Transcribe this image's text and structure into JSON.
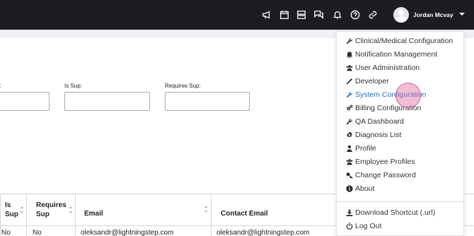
{
  "topbar": {
    "icons": [
      "megaphone-icon",
      "calendar-icon",
      "server-icon",
      "chat-icon",
      "bell-icon",
      "help-icon",
      "link-icon"
    ],
    "user_name": "Jordan Mcvay"
  },
  "filters": {
    "partial_label": ":",
    "is_sup_label": "Is Sup:",
    "requires_sup_label": "Requires Sup:"
  },
  "table": {
    "headers": {
      "is_sup": "Is\nSup",
      "requires_sup": "Requires\nSup",
      "email": "Email",
      "contact_email": "Contact Email"
    },
    "row": {
      "col0": "No",
      "requires_sup": "No",
      "email": "oleksandr@lightningstep.com",
      "contact_email": "oleksandr@lightningstep.com"
    }
  },
  "menu": {
    "items": [
      {
        "label": "Clinical/Medical Configuration",
        "icon": "wrench-icon"
      },
      {
        "label": "Notification Management",
        "icon": "bell-icon"
      },
      {
        "label": "User Administration",
        "icon": "users-icon"
      },
      {
        "label": "Developer",
        "icon": "magic-wand-icon"
      },
      {
        "label": "System Configuration",
        "icon": "wrench-icon",
        "active": true
      },
      {
        "label": "Billing Configuration",
        "icon": "cogs-icon"
      },
      {
        "label": "QA Dashboard",
        "icon": "wrench-icon"
      },
      {
        "label": "Diagnosis List",
        "icon": "gear-icon"
      },
      {
        "label": "Profile",
        "icon": "user-icon"
      },
      {
        "label": "Employee Profiles",
        "icon": "users-icon"
      },
      {
        "label": "Change Password",
        "icon": "key-icon"
      },
      {
        "label": "About",
        "icon": "info-icon"
      }
    ],
    "footer_items": [
      {
        "label": "Download Shortcut (.url)",
        "icon": "download-icon"
      },
      {
        "label": "Log Out",
        "icon": "power-icon"
      }
    ]
  },
  "colors": {
    "topbar": "#1b1d22",
    "active_menu": "#2f6fb5",
    "background": "#eef0f3"
  }
}
